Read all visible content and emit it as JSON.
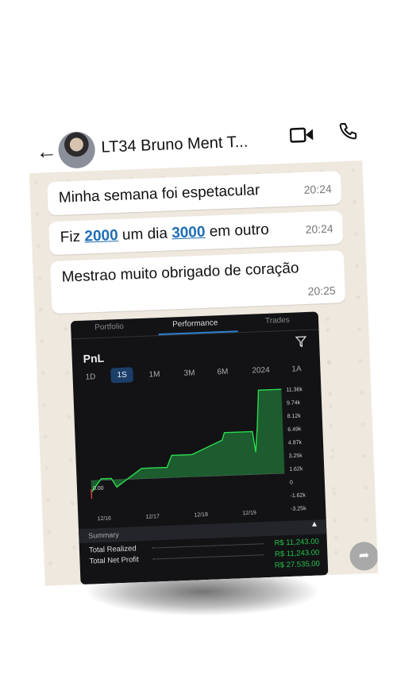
{
  "header": {
    "contact_name": "LT34 Bruno Ment T...",
    "icons": [
      "back-arrow-icon",
      "video-call-icon",
      "phone-icon"
    ]
  },
  "messages": [
    {
      "parts": [
        "Minha semana foi espetacular"
      ],
      "time": "20:24"
    },
    {
      "parts": [
        "Fiz ",
        "2000",
        " um dia ",
        "3000",
        " em outro"
      ],
      "time": "20:24"
    },
    {
      "parts": [
        "Mestrao muito obrigado de coração"
      ],
      "time": "20:25"
    }
  ],
  "screenshot": {
    "tabs": [
      "Portfolio",
      "Performance",
      "Trades"
    ],
    "active_tab": "Performance",
    "pnl_label": "PnL",
    "ranges": [
      "1D",
      "1S",
      "1M",
      "3M",
      "6M",
      "2024",
      "1A"
    ],
    "active_range": "1S",
    "summary_label": "Summary",
    "summary_rows": [
      {
        "label": "Total Realized",
        "value": "R$ 11,243.00"
      },
      {
        "label": "Total Net Profit",
        "value": "R$ 11,243.00"
      },
      {
        "label": "",
        "value": "R$ 27.535,00"
      }
    ]
  },
  "chart_data": {
    "type": "area",
    "x_tick_labels": [
      "12/16",
      "12/17",
      "12/18",
      "12/19"
    ],
    "y_tick_labels": [
      "11.36k",
      "9.74k",
      "8.12k",
      "6.49k",
      "4.87k",
      "3.25k",
      "1.62k",
      "0",
      "-1.62k",
      "-3.25k"
    ],
    "ylim": [
      -3.25,
      11.36
    ],
    "start_label": "0.00",
    "series": [
      {
        "x": [
          0,
          0.2,
          0.4,
          0.5,
          1.0,
          1.5,
          1.6,
          2.0,
          2.6,
          2.65,
          3.2,
          3.25,
          3.3,
          3.35,
          3.8
        ],
        "y": [
          -1.6,
          0.2,
          0.2,
          -1.0,
          1.4,
          1.4,
          3.0,
          3.0,
          4.8,
          5.8,
          5.8,
          3.0,
          6.5,
          11.36,
          11.36
        ]
      }
    ],
    "colors": {
      "line": "#2cdc4f",
      "fill": "#1f6a33"
    }
  }
}
